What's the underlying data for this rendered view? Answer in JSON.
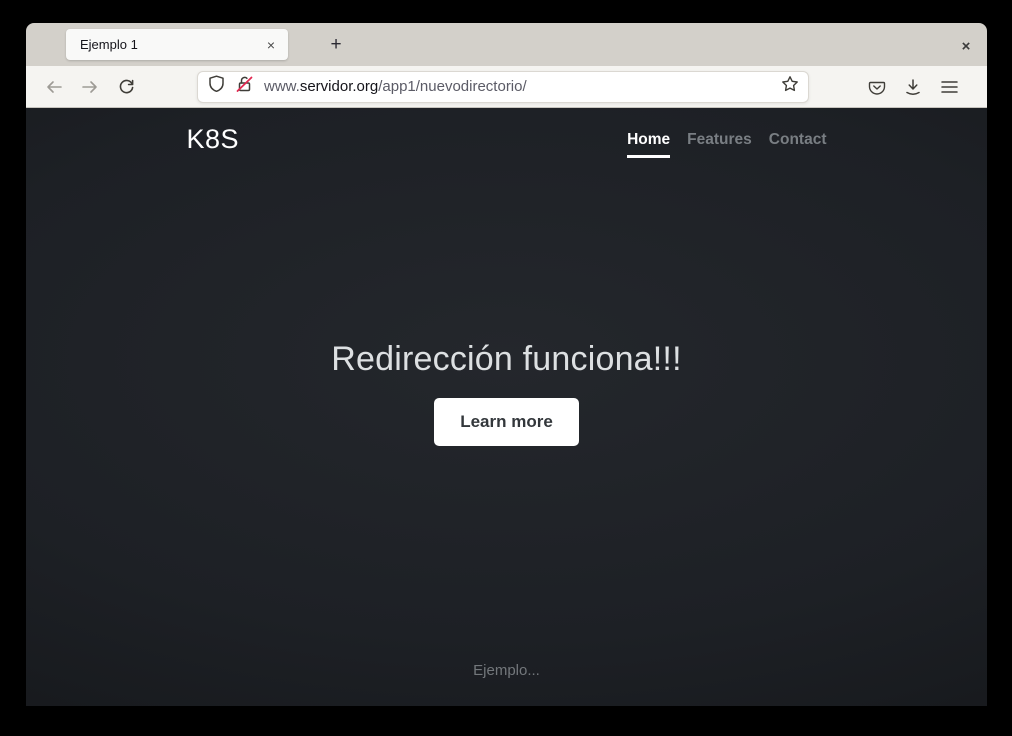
{
  "window": {
    "close_label": "×"
  },
  "tab_bar": {
    "tab": {
      "title": "Ejemplo 1",
      "close_label": "×"
    },
    "new_tab_label": "+"
  },
  "toolbar": {
    "url": {
      "prefix": "www.",
      "domain": "servidor.org",
      "path": "/app1/nuevodirectorio/"
    }
  },
  "page": {
    "brand": "K8S",
    "nav": [
      {
        "label": "Home",
        "active": true
      },
      {
        "label": "Features",
        "active": false
      },
      {
        "label": "Contact",
        "active": false
      }
    ],
    "hero": {
      "heading": "Redirección funciona!!!",
      "button_label": "Learn more"
    },
    "footer_text": "Ejemplo..."
  },
  "colors": {
    "page_background": "#1d2025",
    "tab_bar_background": "#d3d0ca",
    "toolbar_background": "#f5f4f1",
    "accent_text": "#ffffff",
    "muted_text": "#797e83",
    "insecure_slash": "#e22850"
  }
}
